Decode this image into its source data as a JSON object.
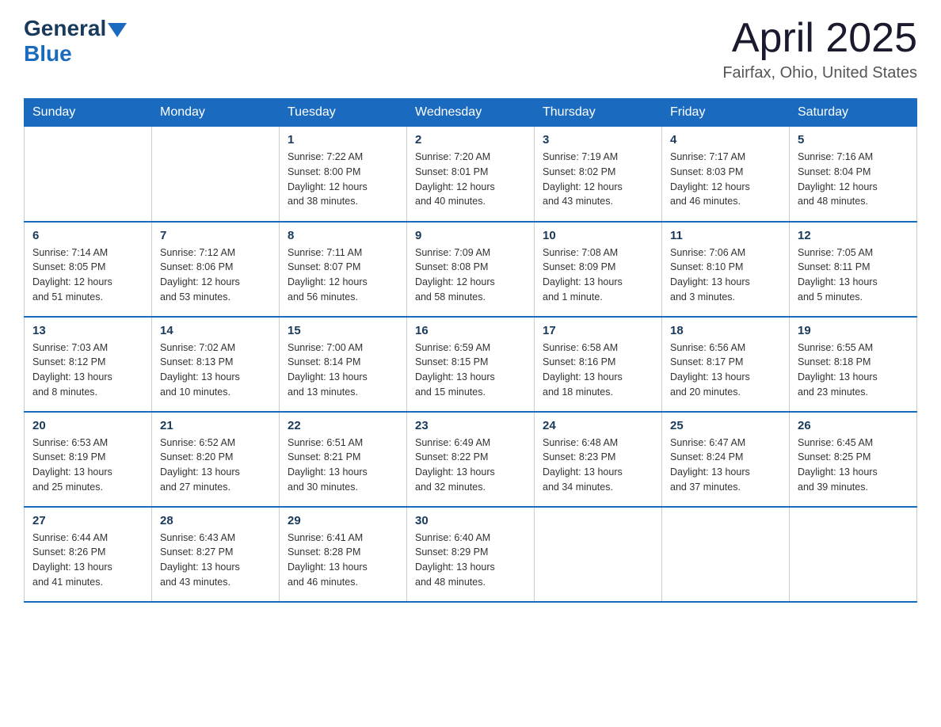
{
  "header": {
    "logo_general": "General",
    "logo_blue": "Blue",
    "month_title": "April 2025",
    "location": "Fairfax, Ohio, United States"
  },
  "days_of_week": [
    "Sunday",
    "Monday",
    "Tuesday",
    "Wednesday",
    "Thursday",
    "Friday",
    "Saturday"
  ],
  "weeks": [
    [
      {
        "day": "",
        "info": ""
      },
      {
        "day": "",
        "info": ""
      },
      {
        "day": "1",
        "info": "Sunrise: 7:22 AM\nSunset: 8:00 PM\nDaylight: 12 hours\nand 38 minutes."
      },
      {
        "day": "2",
        "info": "Sunrise: 7:20 AM\nSunset: 8:01 PM\nDaylight: 12 hours\nand 40 minutes."
      },
      {
        "day": "3",
        "info": "Sunrise: 7:19 AM\nSunset: 8:02 PM\nDaylight: 12 hours\nand 43 minutes."
      },
      {
        "day": "4",
        "info": "Sunrise: 7:17 AM\nSunset: 8:03 PM\nDaylight: 12 hours\nand 46 minutes."
      },
      {
        "day": "5",
        "info": "Sunrise: 7:16 AM\nSunset: 8:04 PM\nDaylight: 12 hours\nand 48 minutes."
      }
    ],
    [
      {
        "day": "6",
        "info": "Sunrise: 7:14 AM\nSunset: 8:05 PM\nDaylight: 12 hours\nand 51 minutes."
      },
      {
        "day": "7",
        "info": "Sunrise: 7:12 AM\nSunset: 8:06 PM\nDaylight: 12 hours\nand 53 minutes."
      },
      {
        "day": "8",
        "info": "Sunrise: 7:11 AM\nSunset: 8:07 PM\nDaylight: 12 hours\nand 56 minutes."
      },
      {
        "day": "9",
        "info": "Sunrise: 7:09 AM\nSunset: 8:08 PM\nDaylight: 12 hours\nand 58 minutes."
      },
      {
        "day": "10",
        "info": "Sunrise: 7:08 AM\nSunset: 8:09 PM\nDaylight: 13 hours\nand 1 minute."
      },
      {
        "day": "11",
        "info": "Sunrise: 7:06 AM\nSunset: 8:10 PM\nDaylight: 13 hours\nand 3 minutes."
      },
      {
        "day": "12",
        "info": "Sunrise: 7:05 AM\nSunset: 8:11 PM\nDaylight: 13 hours\nand 5 minutes."
      }
    ],
    [
      {
        "day": "13",
        "info": "Sunrise: 7:03 AM\nSunset: 8:12 PM\nDaylight: 13 hours\nand 8 minutes."
      },
      {
        "day": "14",
        "info": "Sunrise: 7:02 AM\nSunset: 8:13 PM\nDaylight: 13 hours\nand 10 minutes."
      },
      {
        "day": "15",
        "info": "Sunrise: 7:00 AM\nSunset: 8:14 PM\nDaylight: 13 hours\nand 13 minutes."
      },
      {
        "day": "16",
        "info": "Sunrise: 6:59 AM\nSunset: 8:15 PM\nDaylight: 13 hours\nand 15 minutes."
      },
      {
        "day": "17",
        "info": "Sunrise: 6:58 AM\nSunset: 8:16 PM\nDaylight: 13 hours\nand 18 minutes."
      },
      {
        "day": "18",
        "info": "Sunrise: 6:56 AM\nSunset: 8:17 PM\nDaylight: 13 hours\nand 20 minutes."
      },
      {
        "day": "19",
        "info": "Sunrise: 6:55 AM\nSunset: 8:18 PM\nDaylight: 13 hours\nand 23 minutes."
      }
    ],
    [
      {
        "day": "20",
        "info": "Sunrise: 6:53 AM\nSunset: 8:19 PM\nDaylight: 13 hours\nand 25 minutes."
      },
      {
        "day": "21",
        "info": "Sunrise: 6:52 AM\nSunset: 8:20 PM\nDaylight: 13 hours\nand 27 minutes."
      },
      {
        "day": "22",
        "info": "Sunrise: 6:51 AM\nSunset: 8:21 PM\nDaylight: 13 hours\nand 30 minutes."
      },
      {
        "day": "23",
        "info": "Sunrise: 6:49 AM\nSunset: 8:22 PM\nDaylight: 13 hours\nand 32 minutes."
      },
      {
        "day": "24",
        "info": "Sunrise: 6:48 AM\nSunset: 8:23 PM\nDaylight: 13 hours\nand 34 minutes."
      },
      {
        "day": "25",
        "info": "Sunrise: 6:47 AM\nSunset: 8:24 PM\nDaylight: 13 hours\nand 37 minutes."
      },
      {
        "day": "26",
        "info": "Sunrise: 6:45 AM\nSunset: 8:25 PM\nDaylight: 13 hours\nand 39 minutes."
      }
    ],
    [
      {
        "day": "27",
        "info": "Sunrise: 6:44 AM\nSunset: 8:26 PM\nDaylight: 13 hours\nand 41 minutes."
      },
      {
        "day": "28",
        "info": "Sunrise: 6:43 AM\nSunset: 8:27 PM\nDaylight: 13 hours\nand 43 minutes."
      },
      {
        "day": "29",
        "info": "Sunrise: 6:41 AM\nSunset: 8:28 PM\nDaylight: 13 hours\nand 46 minutes."
      },
      {
        "day": "30",
        "info": "Sunrise: 6:40 AM\nSunset: 8:29 PM\nDaylight: 13 hours\nand 48 minutes."
      },
      {
        "day": "",
        "info": ""
      },
      {
        "day": "",
        "info": ""
      },
      {
        "day": "",
        "info": ""
      }
    ]
  ]
}
